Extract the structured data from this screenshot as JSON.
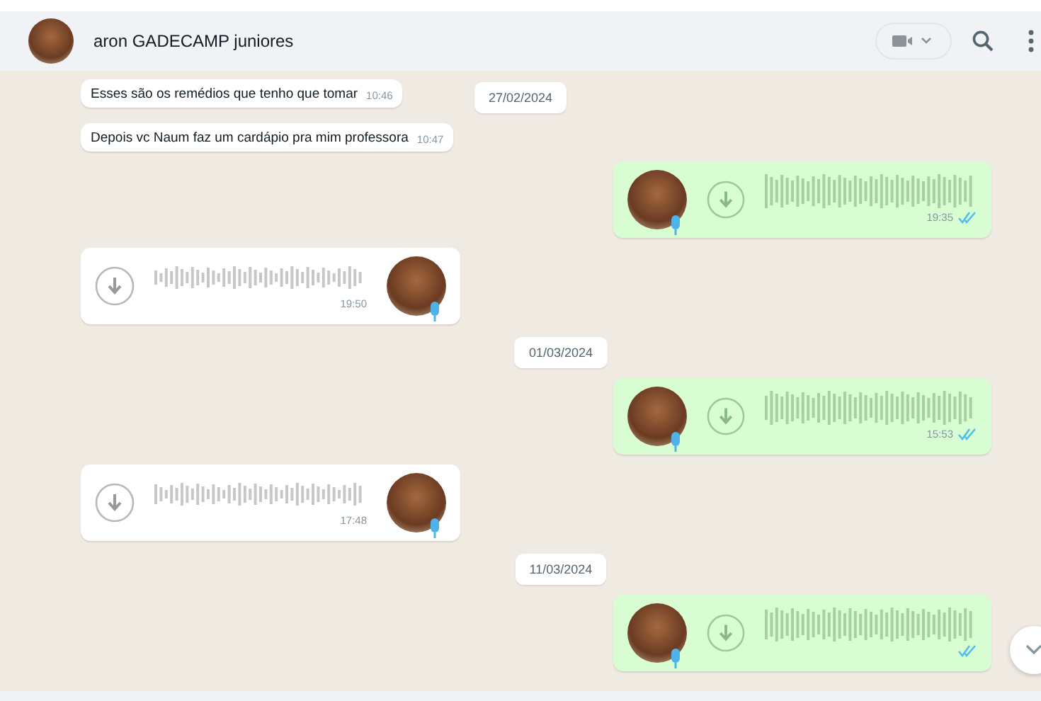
{
  "header": {
    "contact_name": "aron GADECAMP juniores"
  },
  "rows": [
    {
      "items": [
        {
          "kind": "text",
          "outgoing": false,
          "text": "Esses são os remédios que tenho que tomar",
          "time": "10:46"
        },
        {
          "kind": "date",
          "text": "27/02/2024"
        }
      ]
    },
    {
      "items": [
        {
          "kind": "text",
          "outgoing": false,
          "text": "Depois vc Naum faz um cardápio pra mim professora",
          "time": "10:47"
        }
      ]
    },
    {
      "items": [
        {
          "kind": "voice",
          "outgoing": true,
          "time": "19:35",
          "read": true
        }
      ]
    },
    {
      "items": [
        {
          "kind": "voice",
          "outgoing": false,
          "time": "19:50"
        }
      ]
    },
    {
      "items": [
        {
          "kind": "date",
          "text": "01/03/2024"
        }
      ]
    },
    {
      "items": [
        {
          "kind": "voice",
          "outgoing": true,
          "time": "15:53",
          "read": true
        }
      ]
    },
    {
      "items": [
        {
          "kind": "voice",
          "outgoing": false,
          "time": "17:48"
        }
      ]
    },
    {
      "items": [
        {
          "kind": "date",
          "text": "11/03/2024"
        }
      ]
    },
    {
      "items": [
        {
          "kind": "voice",
          "outgoing": true,
          "read": true
        }
      ]
    }
  ]
}
